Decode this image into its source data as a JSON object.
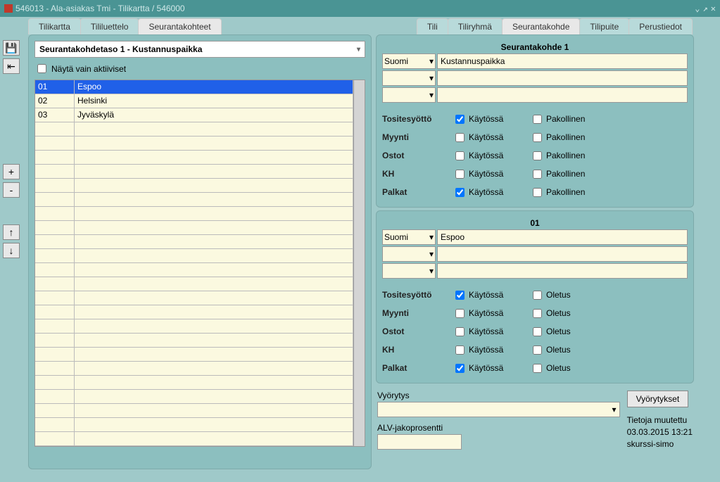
{
  "window": {
    "title": "546013 - Ala-asiakas Tmi - Tilikartta / 546000"
  },
  "tabs_left": [
    {
      "label": "Tilikartta",
      "active": false
    },
    {
      "label": "Tililuettelo",
      "active": false
    },
    {
      "label": "Seurantakohteet",
      "active": true
    }
  ],
  "tabs_right": [
    {
      "label": "Tili",
      "active": false
    },
    {
      "label": "Tiliryhmä",
      "active": false
    },
    {
      "label": "Seurantakohde",
      "active": true
    },
    {
      "label": "Tilipuite",
      "active": false
    },
    {
      "label": "Perustiedot",
      "active": false
    }
  ],
  "left_panel": {
    "header": "Seurantakohdetaso 1 - Kustannuspaikka",
    "show_active_only": "Näytä vain aktiiviset",
    "rows": [
      {
        "code": "01",
        "name": "Espoo",
        "selected": true
      },
      {
        "code": "02",
        "name": "Helsinki",
        "selected": false
      },
      {
        "code": "03",
        "name": "Jyväskylä",
        "selected": false
      }
    ]
  },
  "panel1": {
    "title": "Seurantakohde 1",
    "lang": "Suomi",
    "name": "Kustannuspaikka",
    "opt_labels": [
      "Tositesyöttö",
      "Myynti",
      "Ostot",
      "KH",
      "Palkat"
    ],
    "col1": "Käytössä",
    "col2": "Pakollinen",
    "checks": [
      {
        "c1": true,
        "c2": false
      },
      {
        "c1": false,
        "c2": false
      },
      {
        "c1": false,
        "c2": false
      },
      {
        "c1": false,
        "c2": false
      },
      {
        "c1": true,
        "c2": false
      }
    ]
  },
  "panel2": {
    "title": "01",
    "lang": "Suomi",
    "name": "Espoo",
    "opt_labels": [
      "Tositesyöttö",
      "Myynti",
      "Ostot",
      "KH",
      "Palkat"
    ],
    "col1": "Käytössä",
    "col2": "Oletus",
    "checks": [
      {
        "c1": true,
        "c2": false
      },
      {
        "c1": false,
        "c2": false
      },
      {
        "c1": false,
        "c2": false
      },
      {
        "c1": false,
        "c2": false
      },
      {
        "c1": true,
        "c2": false
      }
    ]
  },
  "bottom": {
    "vyorytys_label": "Vyörytys",
    "vyorytykset_btn": "Vyörytykset",
    "alv_label": "ALV-jakoprosentti",
    "meta_label": "Tietoja muutettu",
    "meta_date": "03.03.2015 13:21",
    "meta_user": "skurssi-simo"
  }
}
